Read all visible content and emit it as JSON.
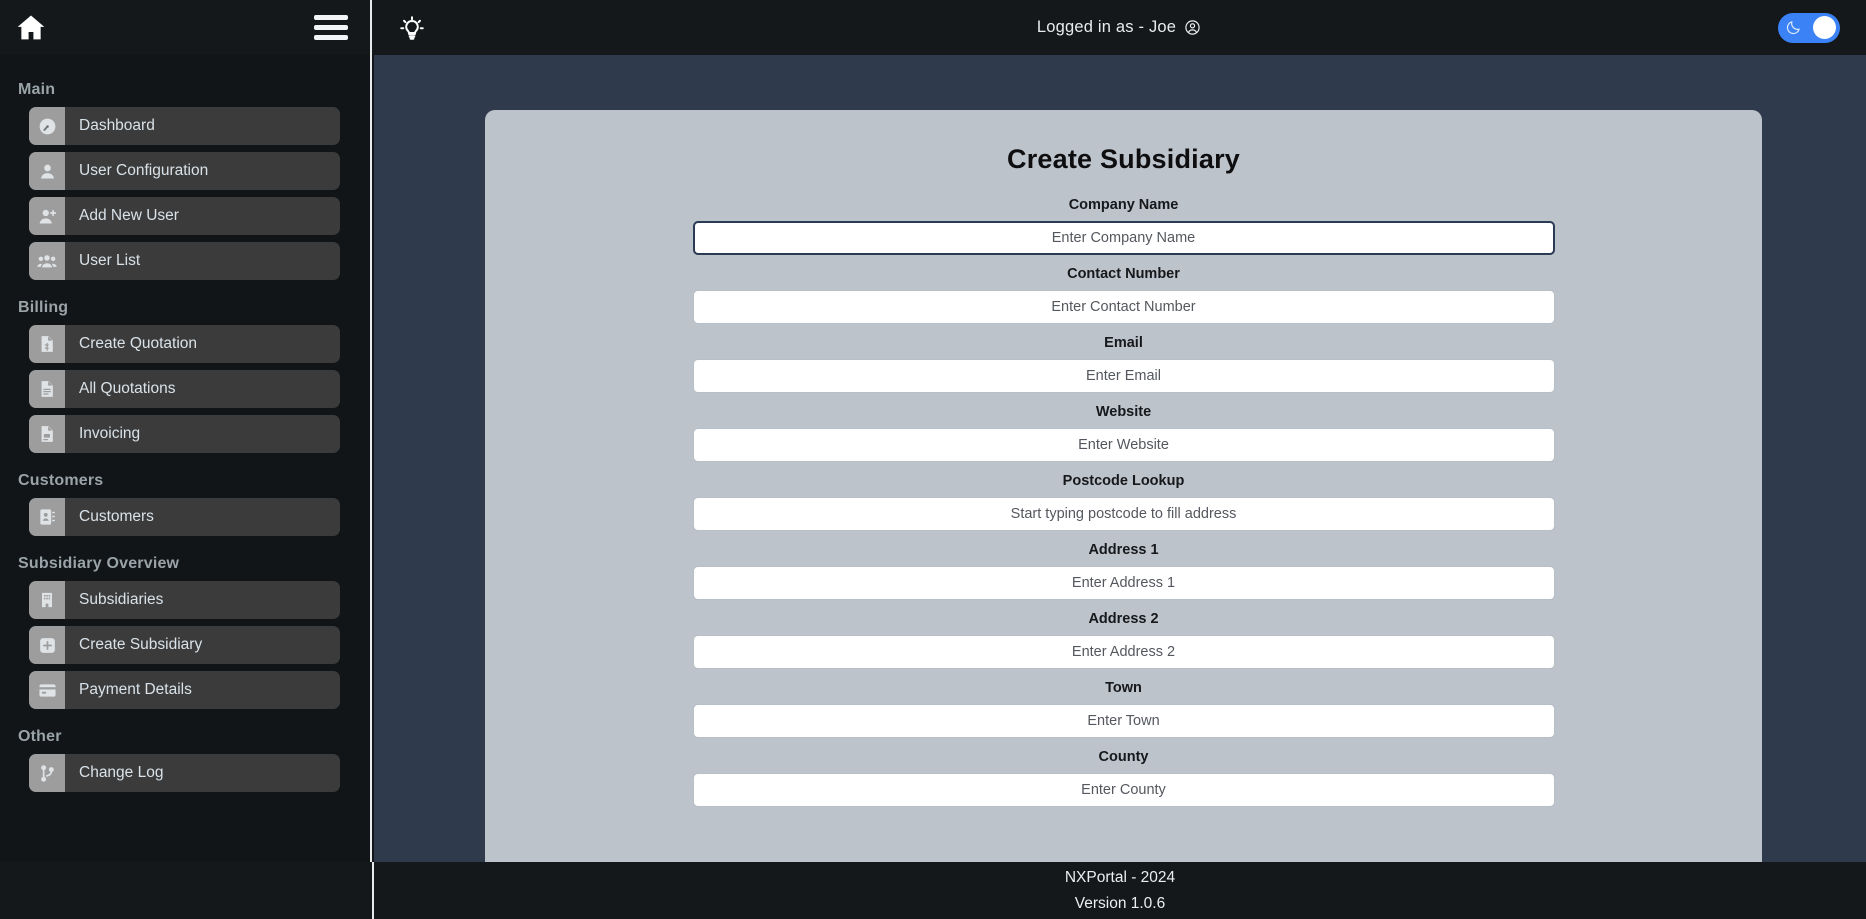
{
  "topbar": {
    "home_icon": "home-icon",
    "menu_icon": "hamburger-menu-icon",
    "bulb_icon": "lightbulb-icon",
    "login_text": "Logged in as - Joe",
    "user_avatar_icon": "user-circle-icon",
    "theme_toggle": {
      "icon": "moon-icon",
      "state": "on",
      "accent_color": "#3b82f6"
    }
  },
  "sidebar": {
    "sections": [
      {
        "title": "Main",
        "items": [
          {
            "label": "Dashboard",
            "icon": "speedometer-icon"
          },
          {
            "label": "User Configuration",
            "icon": "user-icon"
          },
          {
            "label": "Add New User",
            "icon": "user-plus-icon"
          },
          {
            "label": "User List",
            "icon": "users-group-icon"
          }
        ]
      },
      {
        "title": "Billing",
        "items": [
          {
            "label": "Create Quotation",
            "icon": "document-dollar-icon"
          },
          {
            "label": "All Quotations",
            "icon": "document-lines-icon"
          },
          {
            "label": "Invoicing",
            "icon": "invoice-icon"
          }
        ]
      },
      {
        "title": "Customers",
        "items": [
          {
            "label": "Customers",
            "icon": "address-book-icon"
          }
        ]
      },
      {
        "title": "Subsidiary Overview",
        "items": [
          {
            "label": "Subsidiaries",
            "icon": "building-icon"
          },
          {
            "label": "Create Subsidiary",
            "icon": "plus-square-icon"
          },
          {
            "label": "Payment Details",
            "icon": "credit-card-icon"
          }
        ]
      },
      {
        "title": "Other",
        "items": [
          {
            "label": "Change Log",
            "icon": "git-branch-icon"
          }
        ]
      }
    ]
  },
  "main": {
    "card_title": "Create Subsidiary",
    "fields": [
      {
        "label": "Company Name",
        "placeholder": "Enter Company Name",
        "value": "",
        "focused": true
      },
      {
        "label": "Contact Number",
        "placeholder": "Enter Contact Number",
        "value": "",
        "focused": false
      },
      {
        "label": "Email",
        "placeholder": "Enter Email",
        "value": "",
        "focused": false
      },
      {
        "label": "Website",
        "placeholder": "Enter Website",
        "value": "",
        "focused": false
      },
      {
        "label": "Postcode Lookup",
        "placeholder": "Start typing postcode to fill address",
        "value": "",
        "focused": false
      },
      {
        "label": "Address 1",
        "placeholder": "Enter Address 1",
        "value": "",
        "focused": false
      },
      {
        "label": "Address 2",
        "placeholder": "Enter Address 2",
        "value": "",
        "focused": false
      },
      {
        "label": "Town",
        "placeholder": "Enter Town",
        "value": "",
        "focused": false
      },
      {
        "label": "County",
        "placeholder": "Enter County",
        "value": "",
        "focused": false
      }
    ]
  },
  "footer": {
    "line1": "NXPortal - 2024",
    "line2": "Version 1.0.6"
  },
  "colors": {
    "sidebar_bg": "#111517",
    "topbar_bg": "#14181a",
    "content_bg": "#2f3a4c",
    "card_bg": "#bcc3ca",
    "nav_item_bg": "#3b3b3b",
    "nav_icon_bg": "#9d9d9d",
    "accent_blue": "#3b82f6",
    "focus_border": "#2b3a55"
  }
}
